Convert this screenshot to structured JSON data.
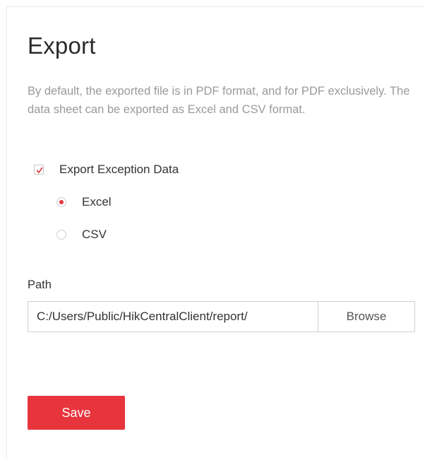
{
  "header": {
    "title": "Export"
  },
  "description": "By default, the exported file is in PDF format, and for PDF exclusively. The data sheet can be exported as Excel and CSV format.",
  "export_exception": {
    "label": "Export Exception Data",
    "checked": true,
    "checkbox_icon": "checkmark-icon"
  },
  "format_options": [
    {
      "label": "Excel",
      "selected": true
    },
    {
      "label": "CSV",
      "selected": false
    }
  ],
  "path": {
    "label": "Path",
    "value": "C:/Users/Public/HikCentralClient/report/",
    "browse_label": "Browse"
  },
  "actions": {
    "save_label": "Save"
  },
  "colors": {
    "accent": "#e8343d",
    "text": "#333333",
    "muted": "#9a9a9a",
    "border": "#cfcfcf"
  }
}
